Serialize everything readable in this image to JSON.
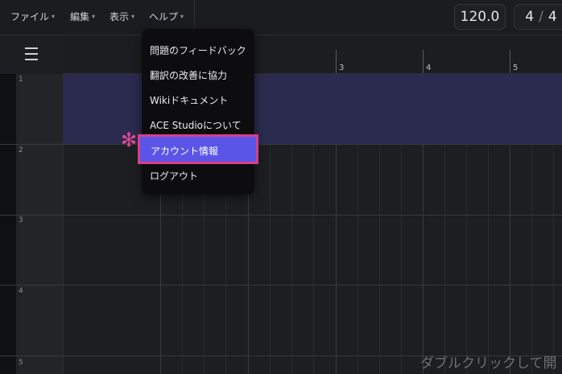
{
  "menubar": {
    "items": [
      {
        "label": "ファイル"
      },
      {
        "label": "編集"
      },
      {
        "label": "表示"
      },
      {
        "label": "ヘルプ"
      }
    ],
    "caret": "▾"
  },
  "transport": {
    "tempo": "120.0",
    "time_sig_num": "4",
    "time_sig_sep": "/",
    "time_sig_den": "4"
  },
  "ruler": {
    "bars": [
      "3",
      "4",
      "5"
    ]
  },
  "tracks": {
    "numbers": [
      "1",
      "2",
      "3",
      "4",
      "5"
    ]
  },
  "help_menu": {
    "items": [
      {
        "label": "問題のフィードバック"
      },
      {
        "label": "翻訳の改善に協力"
      },
      {
        "label": "Wikiドキュメント"
      },
      {
        "label": "ACE Studioについて"
      },
      {
        "label": "アカウント情報"
      },
      {
        "label": "ログアウト"
      }
    ],
    "highlighted_index": 4
  },
  "canvas_hint": "ダブルクリックして開",
  "colors": {
    "highlight_fill": "#5a55e6",
    "highlight_border": "#d63f8a",
    "selected_track": "#2b2b4f"
  }
}
